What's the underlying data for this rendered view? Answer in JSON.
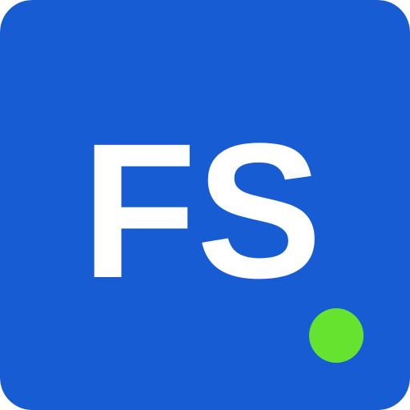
{
  "logo": {
    "monogram": "FS",
    "colors": {
      "background": "#175cd3",
      "text": "#ffffff",
      "status_dot": "#66e32e"
    },
    "status_indicator": "online-dot"
  }
}
